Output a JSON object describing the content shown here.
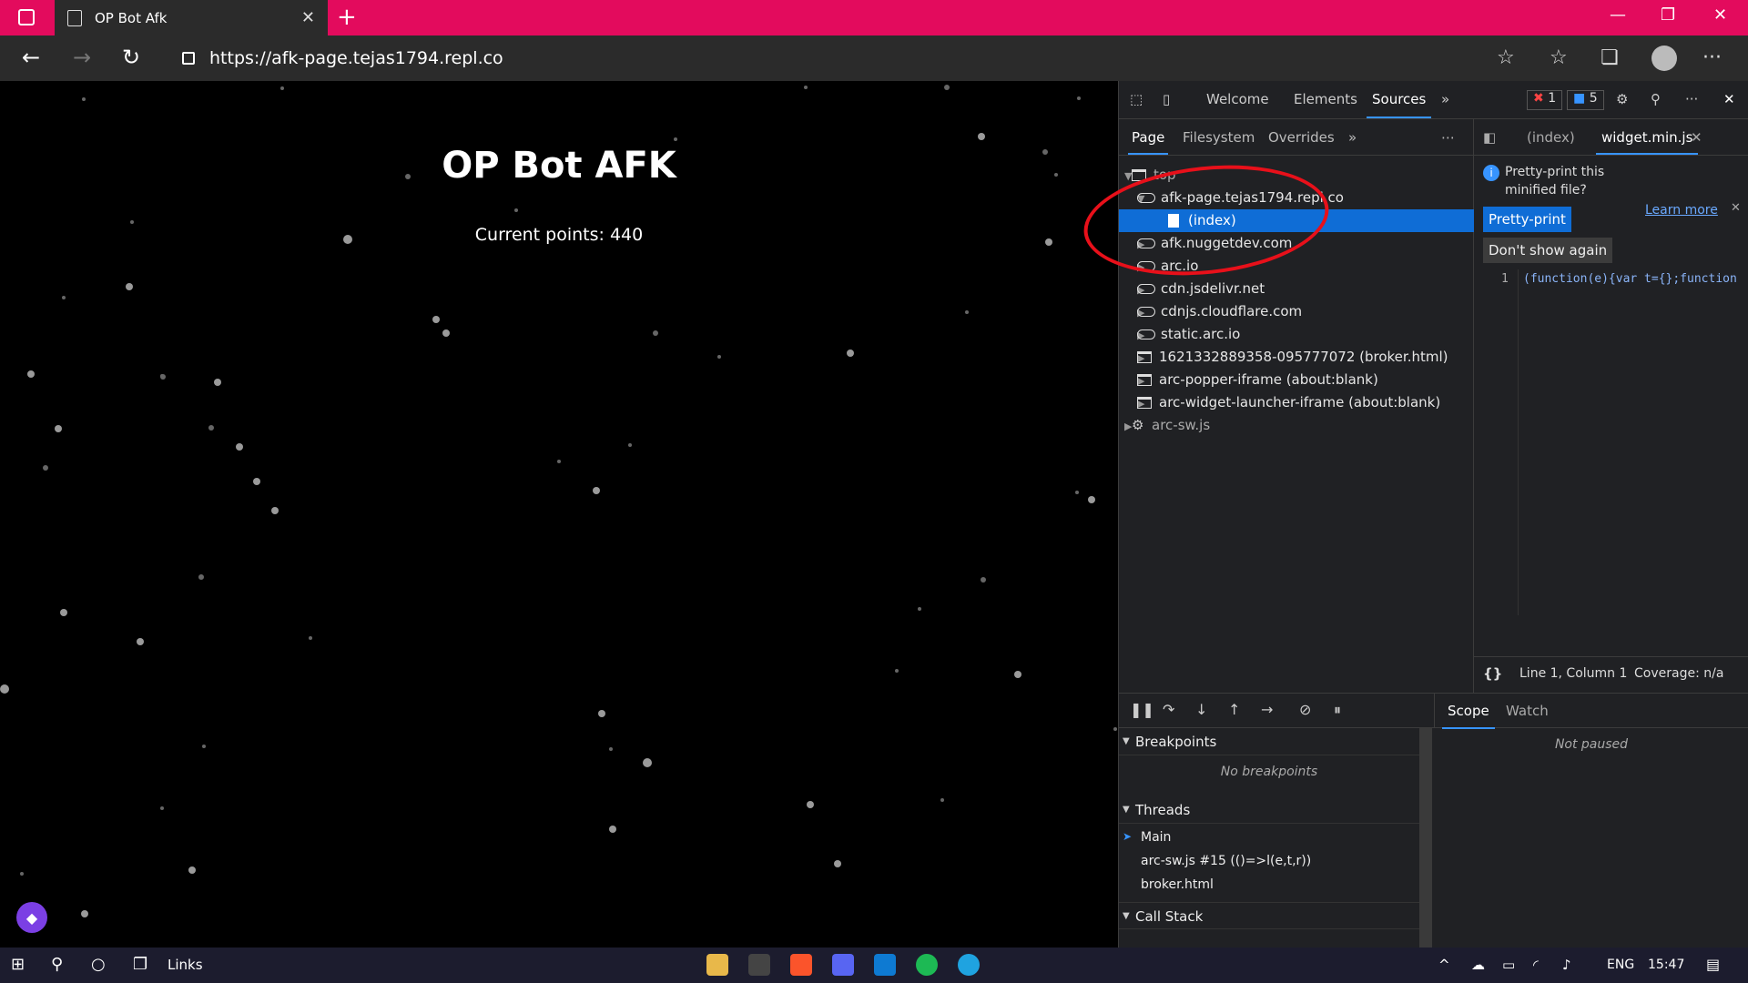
{
  "browser": {
    "tab_title": "OP Bot Afk",
    "url": "https://afk-page.tejas1794.repl.co",
    "accent_color": "#e30b5d"
  },
  "page": {
    "title": "OP Bot AFK",
    "points_text": "Current points: 440"
  },
  "devtools": {
    "tabs": [
      "Welcome",
      "Elements",
      "Sources"
    ],
    "active_tab": "Sources",
    "error_count": "1",
    "message_count": "5",
    "navigator_tabs": [
      "Page",
      "Filesystem",
      "Overrides"
    ],
    "tree": [
      {
        "label": "top",
        "type": "frame",
        "indent": 0
      },
      {
        "label": "afk-page.tejas1794.repl.co",
        "type": "cloud",
        "indent": 1
      },
      {
        "label": "(index)",
        "type": "doc",
        "indent": 2
      },
      {
        "label": "afk.nuggetdev.com",
        "type": "cloud",
        "indent": 1
      },
      {
        "label": "arc.io",
        "type": "cloud",
        "indent": 1
      },
      {
        "label": "cdn.jsdelivr.net",
        "type": "cloud",
        "indent": 1
      },
      {
        "label": "cdnjs.cloudflare.com",
        "type": "cloud",
        "indent": 1
      },
      {
        "label": "static.arc.io",
        "type": "cloud",
        "indent": 1
      },
      {
        "label": "1621332889358-095777072 (broker.html)",
        "type": "frame",
        "indent": 1
      },
      {
        "label": "arc-popper-iframe (about:blank)",
        "type": "frame",
        "indent": 1
      },
      {
        "label": "arc-widget-launcher-iframe (about:blank)",
        "type": "frame",
        "indent": 1
      },
      {
        "label": "arc-sw.js",
        "type": "gear",
        "indent": 0
      }
    ],
    "editor_tabs": [
      "(index)",
      "widget.min.js"
    ],
    "pretty_print_msg": "Pretty-print this minified file?",
    "learn_more": "Learn more",
    "pretty_print_btn": "Pretty-print",
    "dont_show_btn": "Don't show again",
    "line_number": "1",
    "code_line": "(function(e){var t={};function",
    "status_position": "Line 1, Column 1",
    "status_coverage": "Coverage: n/a",
    "scope_tabs": [
      "Scope",
      "Watch"
    ],
    "not_paused": "Not paused",
    "breakpoints_title": "Breakpoints",
    "no_breakpoints": "No breakpoints",
    "threads_title": "Threads",
    "threads": [
      "Main",
      "arc-sw.js #15 (()=>l(e,t,r))",
      "broker.html"
    ],
    "callstack_title": "Call Stack"
  },
  "taskbar": {
    "links_label": "Links",
    "language": "ENG",
    "time": "15:47"
  }
}
